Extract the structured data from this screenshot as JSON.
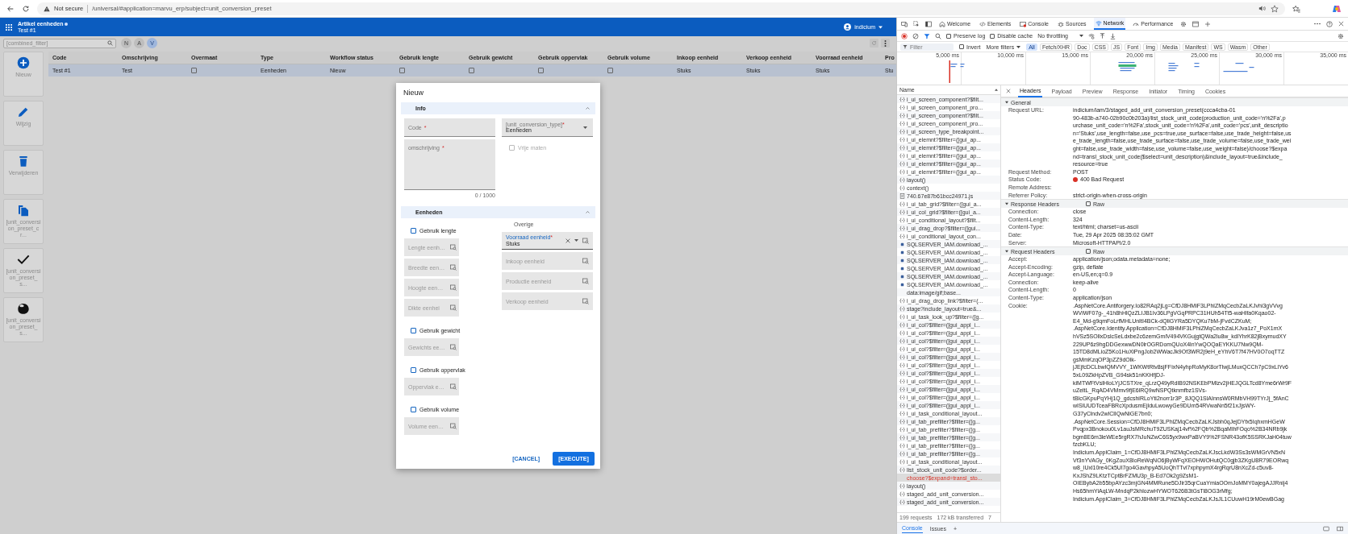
{
  "browser": {
    "security_label": "Not secure",
    "url": "/universal/#application=marvu_erp/subject=unit_conversion_preset"
  },
  "app": {
    "title": "Artikel eenheden",
    "subtitle": "Test #1",
    "user": "indicium",
    "filter": {
      "placeholder": "[combined_filter]"
    },
    "chips": [
      {
        "label": "N",
        "selected": false
      },
      {
        "label": "A",
        "selected": false
      },
      {
        "label": "V",
        "selected": true
      }
    ],
    "sidebar": [
      {
        "label": "Nieuw"
      },
      {
        "label": "Wijzig"
      },
      {
        "label": "Verwijderen"
      },
      {
        "label": "[unit_conversion_preset_cr..."
      },
      {
        "label": "[unit_conversion_preset_s..."
      },
      {
        "label": "[unit_conversion_preset_s..."
      }
    ],
    "table": {
      "columns": [
        "Code",
        "Omschrijving",
        "Overmaat",
        "Type",
        "Workflow status",
        "Gebruik lengte",
        "Gebruik gewicht",
        "Gebruik oppervlak",
        "Gebruik volume",
        "Inkoop eenheid",
        "Verkoop eenheid",
        "Voorraad eenheid",
        "Pro"
      ],
      "rows": [
        {
          "selected": true,
          "cells": [
            {
              "kind": "text",
              "text": "Test #1"
            },
            {
              "kind": "text",
              "text": "Test"
            },
            {
              "kind": "checkbox",
              "checked": false
            },
            {
              "kind": "text",
              "text": "Eenheden"
            },
            {
              "kind": "text",
              "text": "Nieuw"
            },
            {
              "kind": "checkbox",
              "checked": false
            },
            {
              "kind": "checkbox",
              "checked": false
            },
            {
              "kind": "checkbox",
              "checked": false
            },
            {
              "kind": "checkbox",
              "checked": false
            },
            {
              "kind": "text",
              "text": "Stuks"
            },
            {
              "kind": "text",
              "text": "Stuks"
            },
            {
              "kind": "text",
              "text": "Stuks"
            },
            {
              "kind": "text",
              "text": "Stu"
            }
          ]
        }
      ]
    }
  },
  "dialog": {
    "title": "Nieuw",
    "info": {
      "title": "Info",
      "expanded": true,
      "code": {
        "label": "Code",
        "required_mark": "*"
      },
      "type": {
        "label": "[unit_conversion_type]",
        "required_mark": "*",
        "value": "Eenheden"
      },
      "description": {
        "label": "omschrijving",
        "required_mark": "*",
        "counter": "0 / 1000"
      },
      "free_sizes": {
        "label": "Vrije maten",
        "checked": false,
        "disabled": true
      }
    },
    "units": {
      "title": "Eenheden",
      "expanded": true,
      "groups": [
        {
          "label": "Gebruik lengte",
          "checked": false,
          "fields": [
            "Lengte eenh…",
            "Breedte een…",
            "Hoogte een…",
            "Dikte eenhei"
          ]
        },
        {
          "label": "Gebruik gewicht",
          "checked": false,
          "fields": [
            "Gewichts ee…"
          ]
        },
        {
          "label": "Gebruik oppervlak",
          "checked": false,
          "fields": [
            "Oppervlak e…"
          ]
        },
        {
          "label": "Gebruik volume",
          "checked": false,
          "fields": [
            "Volume een…"
          ]
        }
      ],
      "other": {
        "title": "Overige",
        "fields": [
          {
            "label": "Voorraad eenheid",
            "required_mark": "*",
            "value": "Stuks"
          },
          {
            "label": "Inkoop eenheid"
          },
          {
            "label": "Productie eenheid"
          },
          {
            "label": "Verkoop eenheid"
          }
        ]
      }
    },
    "buttons": [
      {
        "label": "[CANCEL]",
        "kind": "text"
      },
      {
        "label": "[EXECUTE]",
        "kind": "primary"
      }
    ]
  },
  "devtools": {
    "tabs": [
      {
        "label": "Welcome",
        "selected": false
      },
      {
        "label": "Elements",
        "selected": false
      },
      {
        "label": "Console",
        "selected": false
      },
      {
        "label": "Sources",
        "selected": false
      },
      {
        "label": "Network",
        "selected": true
      },
      {
        "label": "Performance",
        "selected": false
      }
    ],
    "preserve_log": {
      "label": "Preserve log",
      "checked": false
    },
    "disable_cache": {
      "label": "Disable cache",
      "checked": false
    },
    "throttling": "No throttling",
    "filter": {
      "placeholder": "Filter"
    },
    "invert": {
      "label": "Invert",
      "checked": false
    },
    "more_filters": "More filters",
    "types": [
      {
        "label": "All",
        "selected": true
      },
      {
        "label": "Fetch/XHR",
        "selected": false
      },
      {
        "label": "Doc",
        "selected": false
      },
      {
        "label": "CSS",
        "selected": false
      },
      {
        "label": "JS",
        "selected": false
      },
      {
        "label": "Font",
        "selected": false
      },
      {
        "label": "Img",
        "selected": false
      },
      {
        "label": "Media",
        "selected": false
      },
      {
        "label": "Manifest",
        "selected": false
      },
      {
        "label": "WS",
        "selected": false
      },
      {
        "label": "Wasm",
        "selected": false
      },
      {
        "label": "Other",
        "selected": false
      }
    ],
    "timeline_ticks": [
      "5,000 ms",
      "10,000 ms",
      "15,000 ms",
      "20,000 ms",
      "25,000 ms",
      "30,000 ms",
      "35,000 ms"
    ],
    "list_header": "Name",
    "requests": [
      {
        "name": "i_ui_screen_component?$filt...",
        "kind": "fetch",
        "selected": false
      },
      {
        "name": "i_ui_screen_component_pro...",
        "kind": "fetch",
        "selected": false
      },
      {
        "name": "i_ui_screen_component?$filt...",
        "kind": "fetch",
        "selected": false
      },
      {
        "name": "i_ui_screen_component_pro...",
        "kind": "fetch",
        "selected": false
      },
      {
        "name": "i_ui_screen_type_breakpoint...",
        "kind": "fetch",
        "selected": false
      },
      {
        "name": "i_ui_elemnt?$filter=([gui_ap...",
        "kind": "fetch",
        "selected": false
      },
      {
        "name": "i_ui_elemnt?$filter=([gui_ap...",
        "kind": "fetch",
        "selected": false
      },
      {
        "name": "i_ui_elemnt?$filter=([gui_ap...",
        "kind": "fetch",
        "selected": false
      },
      {
        "name": "i_ui_elemnt?$filter=([gui_ap...",
        "kind": "fetch",
        "selected": false
      },
      {
        "name": "i_ui_elemnt?$filter=([gui_ap...",
        "kind": "fetch",
        "selected": false
      },
      {
        "name": "layout()",
        "kind": "fetch",
        "selected": false
      },
      {
        "name": "context()",
        "kind": "fetch",
        "selected": false
      },
      {
        "name": "740.67e87b61bcc24971.js",
        "kind": "script",
        "selected": false
      },
      {
        "name": "i_ui_tab_grid?$filter=([gui_a...",
        "kind": "fetch",
        "selected": false
      },
      {
        "name": "i_ui_col_grid?$filter=([gui_a...",
        "kind": "fetch",
        "selected": false
      },
      {
        "name": "i_ui_conditional_layout?$filt...",
        "kind": "fetch",
        "selected": false
      },
      {
        "name": "i_ui_drag_drop?$filter=([gui...",
        "kind": "fetch",
        "selected": false
      },
      {
        "name": "i_ui_conditional_layout_con...",
        "kind": "fetch",
        "selected": false
      },
      {
        "name": "SQLSERVER_IAM.download_...",
        "kind": "image",
        "selected": false
      },
      {
        "name": "SQLSERVER_IAM.download_...",
        "kind": "image",
        "selected": false
      },
      {
        "name": "SQLSERVER_IAM.download_...",
        "kind": "image",
        "selected": false
      },
      {
        "name": "SQLSERVER_IAM.download_...",
        "kind": "image",
        "selected": false
      },
      {
        "name": "SQLSERVER_IAM.download_...",
        "kind": "image",
        "selected": false
      },
      {
        "name": "SQLSERVER_IAM.download_...",
        "kind": "image",
        "selected": false
      },
      {
        "name": "data:image/gif;base...",
        "kind": "data",
        "selected": false
      },
      {
        "name": "i_ui_drag_drop_link?$filter=(...",
        "kind": "fetch",
        "selected": false
      },
      {
        "name": "stage?include_layout=true&...",
        "kind": "fetch",
        "selected": false
      },
      {
        "name": "i_ui_task_look_up?$filter=([g...",
        "kind": "fetch",
        "selected": false
      },
      {
        "name": "i_ui_col?$filter=([gui_appl_i...",
        "kind": "fetch",
        "selected": false
      },
      {
        "name": "i_ui_col?$filter=([gui_appl_i...",
        "kind": "fetch",
        "selected": false
      },
      {
        "name": "i_ui_col?$filter=([gui_appl_i...",
        "kind": "fetch",
        "selected": false
      },
      {
        "name": "i_ui_col?$filter=([gui_appl_i...",
        "kind": "fetch",
        "selected": false
      },
      {
        "name": "i_ui_col?$filter=([gui_appl_i...",
        "kind": "fetch",
        "selected": false
      },
      {
        "name": "i_ui_col?$filter=([gui_appl_i...",
        "kind": "fetch",
        "selected": false
      },
      {
        "name": "i_ui_col?$filter=([gui_appl_i...",
        "kind": "fetch",
        "selected": false
      },
      {
        "name": "i_ui_col?$filter=([gui_appl_i...",
        "kind": "fetch",
        "selected": false
      },
      {
        "name": "i_ui_col?$filter=([gui_appl_i...",
        "kind": "fetch",
        "selected": false
      },
      {
        "name": "i_ui_col?$filter=([gui_appl_i...",
        "kind": "fetch",
        "selected": false
      },
      {
        "name": "i_ui_col?$filter=([gui_appl_i...",
        "kind": "fetch",
        "selected": false
      },
      {
        "name": "i_ui_task_conditional_layout...",
        "kind": "fetch",
        "selected": false
      },
      {
        "name": "i_ui_tab_prefilter?$filter=([g...",
        "kind": "fetch",
        "selected": false
      },
      {
        "name": "i_ui_tab_prefilter?$filter=([g...",
        "kind": "fetch",
        "selected": false
      },
      {
        "name": "i_ui_tab_prefilter?$filter=([g...",
        "kind": "fetch",
        "selected": false
      },
      {
        "name": "i_ui_tab_prefilter?$filter=([g...",
        "kind": "fetch",
        "selected": false
      },
      {
        "name": "i_ui_tab_prefilter?$filter=([g...",
        "kind": "fetch",
        "selected": false
      },
      {
        "name": "i_ui_task_conditional_layout...",
        "kind": "fetch",
        "selected": false
      },
      {
        "name": "list_stock_unit_code?$order...",
        "kind": "fetch",
        "selected": false
      },
      {
        "name": "choose?$expand=transl_sto...",
        "kind": "failed",
        "selected": true
      },
      {
        "name": "layout()",
        "kind": "fetch",
        "selected": false
      },
      {
        "name": "staged_add_unit_conversion...",
        "kind": "fetch",
        "selected": false
      },
      {
        "name": "staged_add_unit_conversion...",
        "kind": "fetch",
        "selected": false
      }
    ],
    "summary": [
      "199 requests",
      "172 kB transferred",
      "7"
    ],
    "detail_tabs": [
      {
        "label": "Headers",
        "selected": true
      },
      {
        "label": "Payload",
        "selected": false
      },
      {
        "label": "Preview",
        "selected": false
      },
      {
        "label": "Response",
        "selected": false
      },
      {
        "label": "Initiator",
        "selected": false
      },
      {
        "label": "Timing",
        "selected": false
      },
      {
        "label": "Cookies",
        "selected": false
      }
    ],
    "sections": [
      {
        "title": "General",
        "expanded": true,
        "rows": [
          {
            "name": "Request URL:",
            "lines": [
              "indicium/iam/3/staged_add_unit_conversion_preset(ccca4cba-01",
              "90-483b-a740-02b90c0b203a)/list_stock_unit_code(production_unit_code='n%2Fa',p",
              "urchase_unit_code='n%2Fa',stock_unit_code='n%2Fa',unit_code='pcs',unit_descriptio",
              "n='Stuks',use_length=false,use_pcs=true,use_surface=false,use_trade_height=false,us",
              "e_trade_length=false,use_trade_surface=false,use_trade_volume=false,use_trade_wei",
              "ght=false,use_trade_width=false,use_volume=false,use_weight=false)/choose?$expa",
              "nd=transl_stock_unit_code($select=unit_description)&include_layout=true&include_",
              "resource=true"
            ]
          },
          {
            "name": "Request Method:",
            "lines": [
              "POST"
            ]
          },
          {
            "name": "Status Code:",
            "lines": [
              "400 Bad Request"
            ],
            "color": "#d93025"
          },
          {
            "name": "Remote Address:"
          },
          {
            "name": "Referrer Policy:",
            "lines": [
              "strict-origin-when-cross-origin"
            ]
          }
        ]
      },
      {
        "title": "Response Headers",
        "expanded": true,
        "raw": {
          "label": "Raw",
          "checked": false
        },
        "rows": [
          {
            "name": "Connection:",
            "lines": [
              "close"
            ]
          },
          {
            "name": "Content-Length:",
            "lines": [
              "324"
            ]
          },
          {
            "name": "Content-Type:",
            "lines": [
              "text/html; charset=us-ascii"
            ]
          },
          {
            "name": "Date:",
            "lines": [
              "Tue, 29 Apr 2025 08:35:02 GMT"
            ]
          },
          {
            "name": "Server:",
            "lines": [
              "Microsoft-HTTPAPI/2.0"
            ]
          }
        ]
      },
      {
        "title": "Request Headers",
        "expanded": true,
        "raw": {
          "label": "Raw",
          "checked": false
        },
        "rows": [
          {
            "name": "Accept:",
            "lines": [
              "application/json;odata.metadata=none;"
            ]
          },
          {
            "name": "Accept-Encoding:",
            "lines": [
              "gzip, deflate"
            ]
          },
          {
            "name": "Accept-Language:",
            "lines": [
              "en-US,en;q=0.9"
            ]
          },
          {
            "name": "Connection:",
            "lines": [
              "keep-alive"
            ]
          },
          {
            "name": "Content-Length:",
            "lines": [
              "0"
            ]
          },
          {
            "name": "Content-Type:",
            "lines": [
              "application/json"
            ]
          },
          {
            "name": "Cookie:",
            "lines": [
              ".AspNetCore.Antiforgery.Io82RAq2jLg=CfDJ8HMiF3LPhlZMqCecbZaLKJvhi3gVVvg",
              "WViWF07g-_41h8hHlQzZLIJB1Iv36LPgVGqPRPC31HUh54Tt5-waHlfa0Kqao02-",
              "E4_Md-g9qmFoLrfMHLUnItI4BCk-dQliGYRa5DYQKu7bM-jFvdCZKuM;",
              ".AspNetCore.Identity.Application=CfDJ8HMiF3LPhlZMqCecbZaLKJva1z7_PoX1mX",
              "hVSz5SOllxDslcSeLdxbe2c6zemGmlV494VKGujgtQWa2lu8w_kdlYhrK82jBxymudXY",
              "229UP6z9hgDDGexwwDN0lrOGRDomQUoX4lnYwQOQaEYKKU7Nw9QM-",
              "15TD8dMLioZ5Ko1HuXiPngJob2WWacJk9Of3WR2j9eH_eYhV6T7f47HV0O7oqTTZ",
              "gsMmKzqOP3pZZ9dOlk-",
              "jJEjfcDCLbwlQMVVY_1WKWtRtv8sjFFixN4yhpRoMyK8orTlwjLMuxQCCh7pC9xLlYv6",
              "5xL09ZkHpZVB_G94sk51nKKHfjDJ-",
              "kiMTWFtVslHloLYjJCSTXre_qLrzQ49yRdIB92NSKEbPMlzv2jHEJQGLTcd8Yme6rWr9F",
              "uZeltL_RqAD4VMmv9fjE6lRQ9wNSPQtknmfbz1SVs-",
              "tBlcGKpuPqYHj1Q_gdcshiRLoYti2norr1r3P_8JQQ1SlAInnsW0RMbVH99TYrJj_5fAnC",
              "wISlUUDTceaFBRcXpdusmEjlduLwowyGe9DUm54RVwaNn5f21xJjsWY-",
              "G37yClndv2wlClIQwNiGE7bn0;",
              ".AspNetCore.Session=CfDJ8HMiF3LPhlZMqCecbZaLKJsbh0qJejDYfx5IqhxmHGeW",
              "Pvqpx3Bnokou0Lv1auJsMRchuT9ZUSKaj14vf%2FQb%2BqaMlhFOqo%2B34NRb9jk",
              "bgm8E6m3leWEe5rgRX7hJuNZwC6S5yx9wxPaBVY9%2FSNR43ofK5SSRKJaH04tuw",
              "fzcbKLU;",
              "Indicium.ApplClaim_1=CfDJ8HMiF3LPhlZMqCecbZaLKJscLkdW3Ss3sWMGrVN5xN",
              "Vf3nYVAGy_0KgZouX8IoReWqNO6jByWFqXEOHWOHutQC0gjb3ZKgU8R79EORwq",
              "w8_lUxl10re4Ck5Ul7go4GavhpyA5UoQhTTvl7xphpymX4rgRqrU8nXcZd-c5uv8-",
              "KxJShZ9LKtzTCptBrFZMU3p_B-Ed7Ok2g9ZsM1-",
              "OIEBybA2b55bpAYzc3mjGN4MMRune5DJir35qrCuaYmiaOOmJoMMY0ajegAJJRnij4",
              "Hs65hmYiAqLW-MndqP2khlozwHYWOT626B3tGsTi8OG3rMfg;",
              "Indicium.ApplClaim_3=CfDJ8HMiF3LPhlZMqCecbZaLKJsJL1CUuwH19rM0ewBGag"
            ]
          }
        ]
      }
    ],
    "drawer_tabs": [
      {
        "label": "Console",
        "selected": true
      },
      {
        "label": "Issues",
        "selected": false
      },
      {
        "label": "+",
        "selected": false
      }
    ]
  }
}
